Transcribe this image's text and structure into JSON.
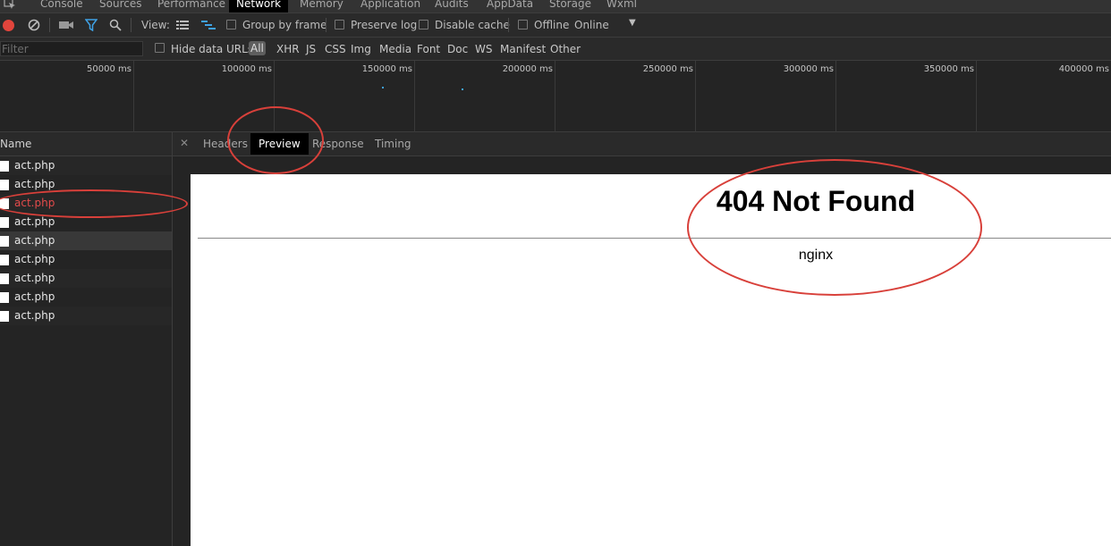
{
  "devtools_tabs": [
    "Console",
    "Sources",
    "Performance",
    "Network",
    "Memory",
    "Application",
    "Audits",
    "AppData",
    "Storage",
    "Wxml"
  ],
  "active_devtools_tab": "Network",
  "toolbar": {
    "view_label": "View:",
    "group_by_frame": "Group by frame",
    "preserve_log": "Preserve log",
    "disable_cache": "Disable cache",
    "offline": "Offline",
    "throttle": "Online"
  },
  "filter": {
    "placeholder": "Filter",
    "hide_data_urls": "Hide data URLs",
    "types": [
      "All",
      "XHR",
      "JS",
      "CSS",
      "Img",
      "Media",
      "Font",
      "Doc",
      "WS",
      "Manifest",
      "Other"
    ]
  },
  "timeline": {
    "ticks": [
      "50000 ms",
      "100000 ms",
      "150000 ms",
      "200000 ms",
      "250000 ms",
      "300000 ms",
      "350000 ms",
      "400000 ms"
    ]
  },
  "requests": {
    "header": "Name",
    "rows": [
      "act.php",
      "act.php",
      "act.php",
      "act.php",
      "act.php",
      "act.php",
      "act.php",
      "act.php",
      "act.php"
    ]
  },
  "detail_tabs": [
    "Headers",
    "Preview",
    "Response",
    "Timing"
  ],
  "active_detail_tab": "Preview",
  "preview": {
    "heading": "404 Not Found",
    "server": "nginx"
  },
  "colors": {
    "record": "#e2453c",
    "error_text": "#e34b4b",
    "annotation": "#d8403a",
    "accent_blue": "#3fa2e6"
  }
}
